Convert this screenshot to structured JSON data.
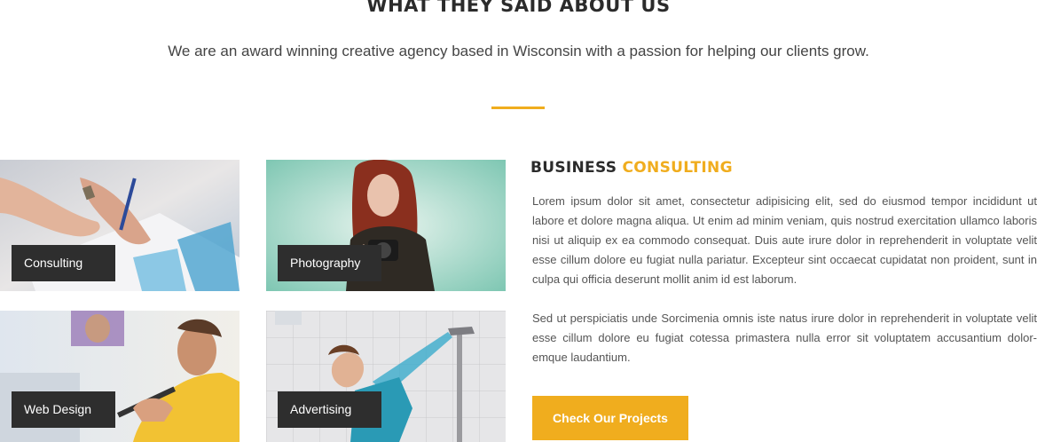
{
  "header": {
    "title": "WHAT THEY SAID ABOUT US",
    "subtitle": "We are an award winning creative agency based in Wisconsin with a passion for helping our clients grow."
  },
  "colors": {
    "accent": "#f0ad1e",
    "label_bg": "#2e2e2e",
    "heading": "#2b2b2b",
    "body_text": "#555555"
  },
  "tiles": [
    {
      "label": "Consulting",
      "image": "hands-working-on-documents-photo"
    },
    {
      "label": "Photography",
      "image": "woman-holding-camera-photo"
    },
    {
      "label": "Web Design",
      "image": "people-working-at-laptops-photo"
    },
    {
      "label": "Advertising",
      "image": "woman-under-shower-photo"
    }
  ],
  "content": {
    "heading_part1": "BUSINESS",
    "heading_part2": "CONSULTING",
    "paragraph_1": "Lorem ipsum dolor sit amet, consectetur adipisicing elit, sed do eiusmod tempor incididunt ut labore et dolore magna aliqua. Ut enim ad minim veniam, quis nostrud exercitation ullamco laboris nisi ut aliquip ex ea commodo consequat. Duis aute irure dolor in reprehenderit in voluptate velit esse cillum dolore eu fugiat nulla pariatur. Excepteur sint occaecat cupidatat non proident, sunt in culpa qui officia deserunt mollit anim id est laborum.",
    "paragraph_2": "Sed ut perspiciatis unde Sorcimenia omnis iste natus irure dolor in reprehenderit in voluptate velit esse cillum dolore eu fugiat cotessa primastera nulla error sit voluptatem accusantium dolor-emque laudantium.",
    "cta_label": "Check Our Projects"
  }
}
